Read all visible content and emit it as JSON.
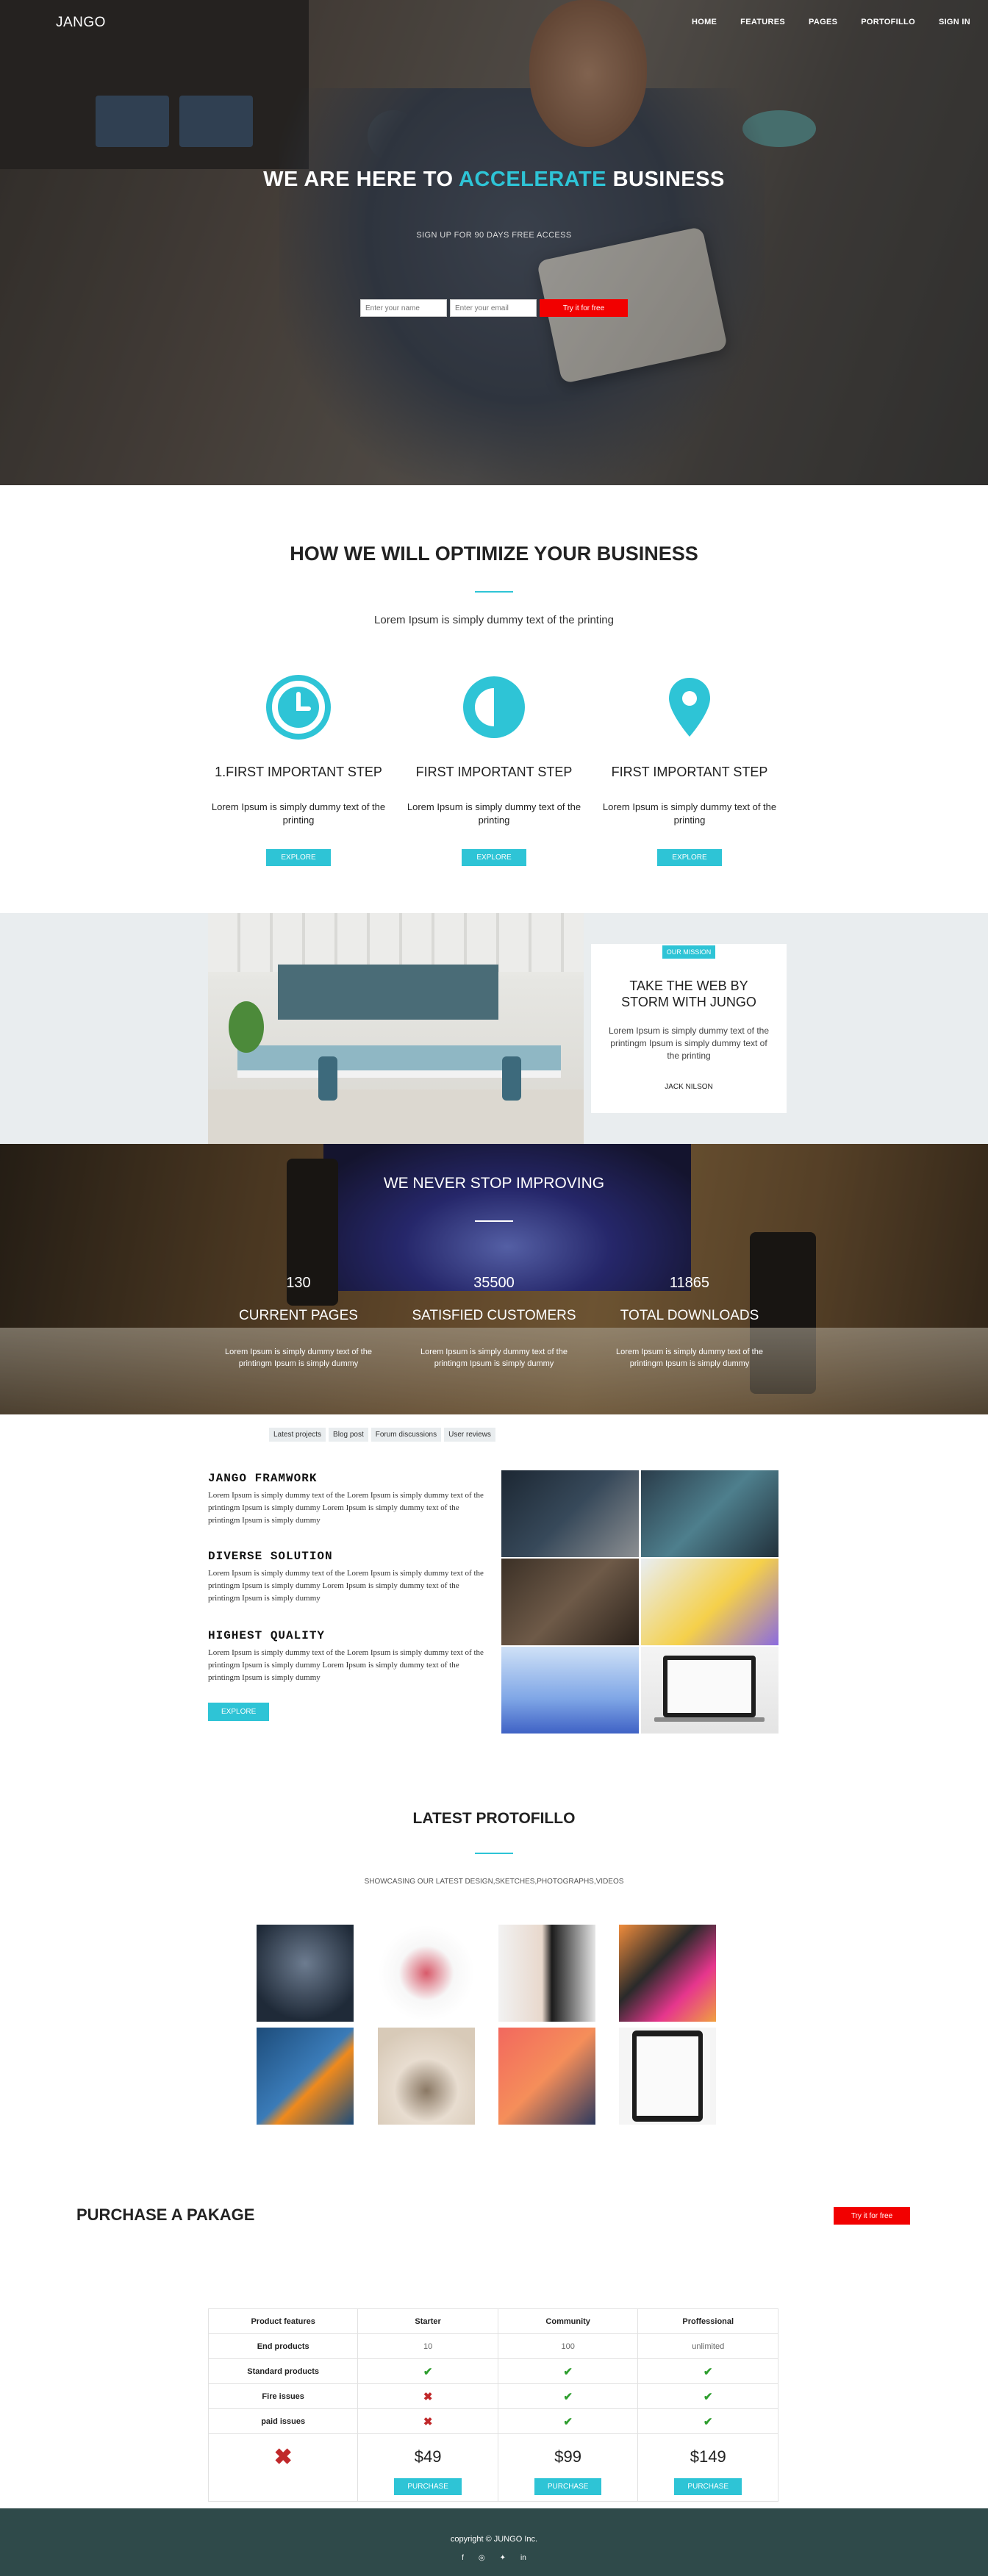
{
  "nav": {
    "brand": "JANGO",
    "items": [
      "HOME",
      "FEATURES",
      "PAGES",
      "PORTOFILLO",
      "SIGN IN"
    ]
  },
  "hero": {
    "title_before": "WE ARE HERE TO ",
    "title_accent": "ACCELERATE",
    "title_after": " BUSINESS",
    "subtitle": "SIGN UP FOR 90 DAYS FREE ACCESS",
    "name_placeholder": "Enter your name",
    "email_placeholder": "Enter your email",
    "cta": "Try it for free"
  },
  "optimize": {
    "title": "HOW WE WILL OPTIMIZE YOUR BUSINESS",
    "subtitle": "Lorem Ipsum is simply dummy text of the printing",
    "features": [
      {
        "icon": "clock-icon",
        "title": "1.FIRST IMPORTANT STEP",
        "text": "Lorem Ipsum is simply dummy text of the printing",
        "button": "EXPLORE"
      },
      {
        "icon": "contrast-icon",
        "title": "FIRST IMPORTANT STEP",
        "text": "Lorem Ipsum is simply dummy text of the printing",
        "button": "EXPLORE"
      },
      {
        "icon": "map-pin-icon",
        "title": "FIRST IMPORTANT STEP",
        "text": "Lorem Ipsum is simply dummy text of the printing",
        "button": "EXPLORE"
      }
    ]
  },
  "mission": {
    "badge": "OUR MISSION",
    "title": "TAKE THE WEB BY STORM WITH JUNGO",
    "text": "Lorem Ipsum is simply dummy text of the printingm Ipsum is simply dummy text of the printing",
    "author": "JACK NILSON"
  },
  "stats": {
    "title": "WE NEVER STOP IMPROVING",
    "items": [
      {
        "number": "130",
        "label": "CURRENT PAGES",
        "text": "Lorem Ipsum is simply dummy text of the printingm Ipsum is simply dummy"
      },
      {
        "number": "35500",
        "label": "SATISFIED CUSTOMERS",
        "text": "Lorem Ipsum is simply dummy text of the printingm Ipsum is simply dummy"
      },
      {
        "number": "11865",
        "label": "TOTAL DOWNLOADS",
        "text": "Lorem Ipsum is simply dummy text of the printingm Ipsum is simply dummy"
      }
    ]
  },
  "tabs": [
    "Latest projects",
    "Blog post",
    "Forum discussions",
    "User reviews"
  ],
  "framework": {
    "blocks": [
      {
        "title": "JANGO FRAMWORK",
        "text": "Lorem Ipsum is simply dummy text of the Lorem Ipsum is simply dummy text of the printingm Ipsum is simply dummy Lorem Ipsum is simply dummy text of the printingm Ipsum is simply dummy"
      },
      {
        "title": "DIVERSE SOLUTION",
        "text": "Lorem Ipsum is simply dummy text of the Lorem Ipsum is simply dummy text of the printingm Ipsum is simply dummy Lorem Ipsum is simply dummy text of the printingm Ipsum is simply dummy"
      },
      {
        "title": "HIGHEST QUALITY",
        "text": "Lorem Ipsum is simply dummy text of the Lorem Ipsum is simply dummy text of the printingm Ipsum is simply dummy Lorem Ipsum is simply dummy text of the printingm Ipsum is simply dummy"
      }
    ],
    "button": "EXPLORE"
  },
  "portfolio": {
    "title": "LATEST PROTOFILLO",
    "subtitle": "SHOWCASING OUR LATEST DESIGN,SKETCHES,PHOTOGRAPHS,VIDEOS"
  },
  "purchase": {
    "title": "PURCHASE A PAKAGE",
    "cta": "Try it for free",
    "headers": [
      "Product features",
      "Starter",
      "Community",
      "Proffessional"
    ],
    "rows": [
      {
        "feature": "End products",
        "values": [
          "10",
          "100",
          "unlimited"
        ]
      },
      {
        "feature": "Standard products",
        "values": [
          "check",
          "check",
          "check"
        ]
      },
      {
        "feature": "Fire issues",
        "values": [
          "cross",
          "check",
          "check"
        ]
      },
      {
        "feature": "paid issues",
        "values": [
          "cross",
          "check",
          "check"
        ]
      }
    ],
    "prices": [
      "$49",
      "$99",
      "$149"
    ],
    "buy_label": "PURCHASE"
  },
  "footer": {
    "copyright": "copyright © JUNGO Inc.",
    "social": [
      "facebook-icon",
      "instagram-icon",
      "twitter-icon",
      "linkedin-icon"
    ]
  },
  "colors": {
    "accent": "#2ec4d6",
    "cta_red": "#f20000",
    "footer": "#2f4a4a"
  }
}
